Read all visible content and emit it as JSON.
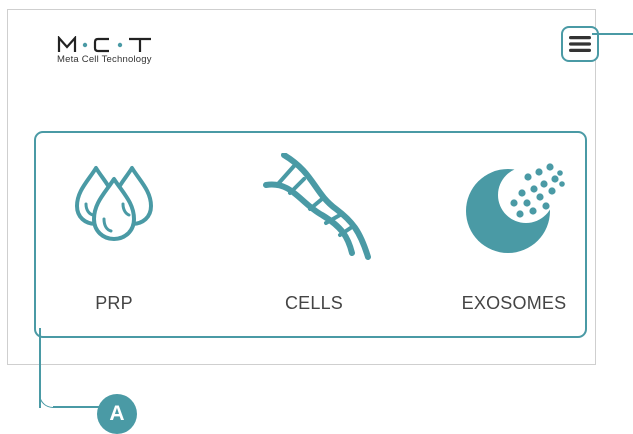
{
  "brand": {
    "logo_text": "M·C·T",
    "tagline": "Meta Cell Technology"
  },
  "header": {
    "menu_icon": "hamburger-menu-icon"
  },
  "categories": [
    {
      "label": "PRP",
      "icon": "drops-icon"
    },
    {
      "label": "CELLS",
      "icon": "dna-icon"
    },
    {
      "label": "EXOSOMES",
      "icon": "exosome-icon"
    }
  ],
  "callout": {
    "badge": "A"
  },
  "colors": {
    "accent": "#4a9aa5",
    "text": "#444444",
    "border": "#cfcfcf"
  }
}
